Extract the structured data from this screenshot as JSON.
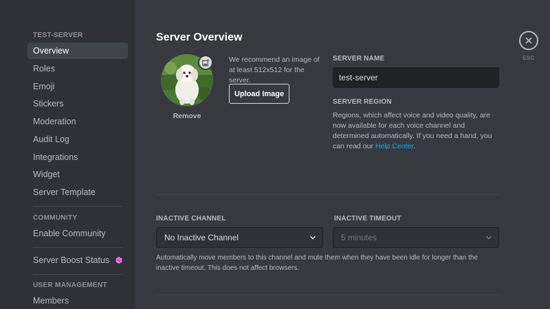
{
  "sidebar": {
    "server_header": "TEST-SERVER",
    "items": [
      {
        "label": "Overview"
      },
      {
        "label": "Roles"
      },
      {
        "label": "Emoji"
      },
      {
        "label": "Stickers"
      },
      {
        "label": "Moderation"
      },
      {
        "label": "Audit Log"
      },
      {
        "label": "Integrations"
      },
      {
        "label": "Widget"
      },
      {
        "label": "Server Template"
      }
    ],
    "community_header": "COMMUNITY",
    "community_item": "Enable Community",
    "boost_item": "Server Boost Status",
    "boost_icon": "boost-gem-icon",
    "user_mgmt_header": "USER MANAGEMENT",
    "members_item": "Members",
    "active_item": "Overview"
  },
  "main": {
    "title": "Server Overview",
    "avatar_remove": "Remove",
    "avatar_edit_icon": "image-upload-icon",
    "image_recommendation": "We recommend an image of at least 512x512 for the server.",
    "upload_button": "Upload Image",
    "server_name_label": "SERVER NAME",
    "server_name_value": "test-server",
    "server_region_label": "SERVER REGION",
    "server_region_text": "Regions, which affect voice and video quality, are now available for each voice channel and determined automatically. If you need a hand, you can read our ",
    "help_center_link": "Help Center",
    "region_text_end": ".",
    "inactive_channel_label": "INACTIVE CHANNEL",
    "inactive_channel_value": "No Inactive Channel",
    "inactive_timeout_label": "INACTIVE TIMEOUT",
    "inactive_timeout_value": "5 minutes",
    "inactive_help": "Automatically move members to this channel and mute them when they have been idle for longer than the inactive timeout. This does not affect browsers.",
    "close_icon": "close-icon",
    "esc_label": "ESC"
  },
  "colors": {
    "background": "#36393f",
    "sidebar": "#2f3136",
    "link": "#00b0f4",
    "boost": "#ff73fa"
  }
}
